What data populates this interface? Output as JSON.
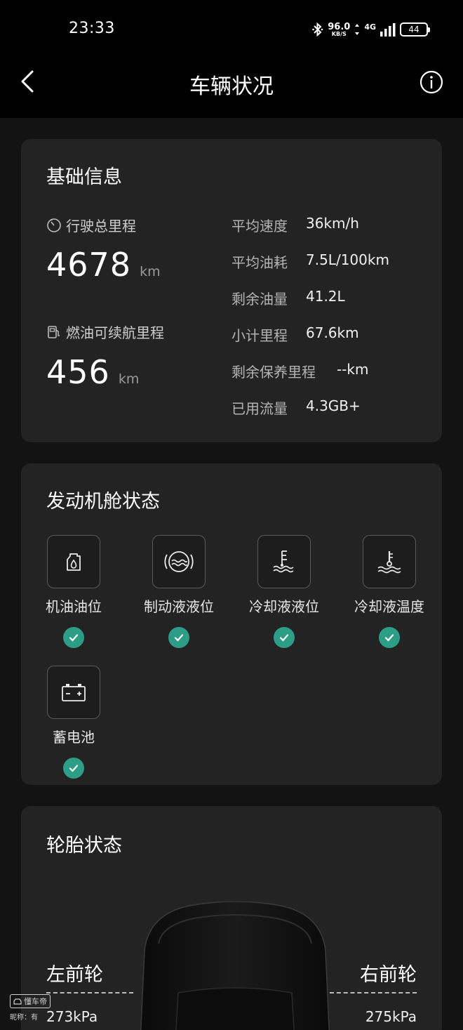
{
  "status": {
    "time": "23:33",
    "net_speed_value": "96.0",
    "net_speed_unit": "KB/S",
    "network": "4G",
    "battery": "44"
  },
  "header": {
    "title": "车辆状况"
  },
  "basic_info": {
    "title": "基础信息",
    "total_mileage_label": "行驶总里程",
    "total_mileage_value": "4678",
    "total_mileage_unit": "km",
    "range_label": "燃油可续航里程",
    "range_value": "456",
    "range_unit": "km",
    "stats": [
      {
        "label": "平均速度",
        "value": "36km/h"
      },
      {
        "label": "平均油耗",
        "value": "7.5L/100km"
      },
      {
        "label": "剩余油量",
        "value": "41.2L"
      },
      {
        "label": "小计里程",
        "value": "67.6km"
      },
      {
        "label": "剩余保养里程",
        "value": "--km"
      },
      {
        "label": "已用流量",
        "value": "4.3GB+"
      }
    ]
  },
  "engine": {
    "title": "发动机舱状态",
    "items": [
      {
        "label": "机油油位",
        "icon": "oil-can-icon",
        "status": "ok"
      },
      {
        "label": "制动液液位",
        "icon": "brake-fluid-icon",
        "status": "ok"
      },
      {
        "label": "冷却液液位",
        "icon": "coolant-level-icon",
        "status": "ok"
      },
      {
        "label": "冷却液温度",
        "icon": "coolant-temp-icon",
        "status": "ok"
      },
      {
        "label": "蓄电池",
        "icon": "battery-icon",
        "status": "ok"
      }
    ],
    "ok_color": "#2c9e86"
  },
  "tires": {
    "title": "轮胎状态",
    "front_left_label": "左前轮",
    "front_right_label": "右前轮",
    "front_left_pressure": "273kPa",
    "front_right_pressure": "275kPa"
  },
  "watermark": {
    "brand": "懂车帝",
    "nickname": "昵称：有"
  }
}
